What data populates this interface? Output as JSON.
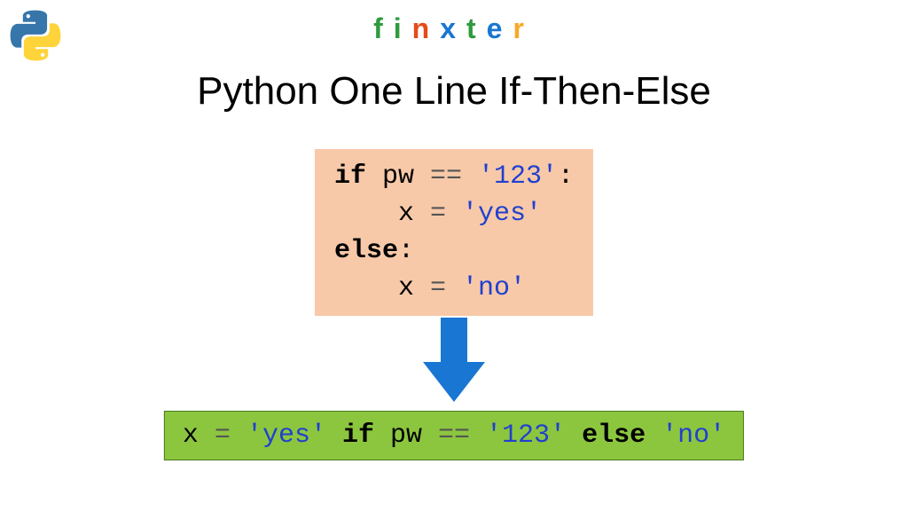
{
  "brand": {
    "letters": [
      "f",
      "i",
      "n",
      "x",
      "t",
      "e",
      "r"
    ],
    "colors": [
      "#2e9b3d",
      "#2e9b3d",
      "#e64a19",
      "#1976d2",
      "#2e9b3d",
      "#1976d2",
      "#f9a825"
    ]
  },
  "title": "Python One Line If-Then-Else",
  "code1": {
    "line1_kw": "if",
    "line1_rest_a": " pw ",
    "line1_op": "==",
    "line1_rest_b": " ",
    "line1_str": "'123'",
    "line1_colon": ":",
    "line2_indent": "    x ",
    "line2_eq": "=",
    "line2_sp": " ",
    "line2_str": "'yes'",
    "line3_kw": "else",
    "line3_colon": ":",
    "line4_indent": "    x ",
    "line4_eq": "=",
    "line4_sp": " ",
    "line4_str": "'no'"
  },
  "code2": {
    "p1": "x ",
    "eq": "=",
    "p2": " ",
    "str1": "'yes'",
    "p3": " ",
    "kw1": "if",
    "p4": " pw ",
    "op": "==",
    "p5": " ",
    "str2": "'123'",
    "p6": " ",
    "kw2": "else",
    "p7": " ",
    "str3": "'no'"
  },
  "colors": {
    "arrow": "#1976d2",
    "box1": "#f7c9a8",
    "box2": "#8cc63f"
  }
}
